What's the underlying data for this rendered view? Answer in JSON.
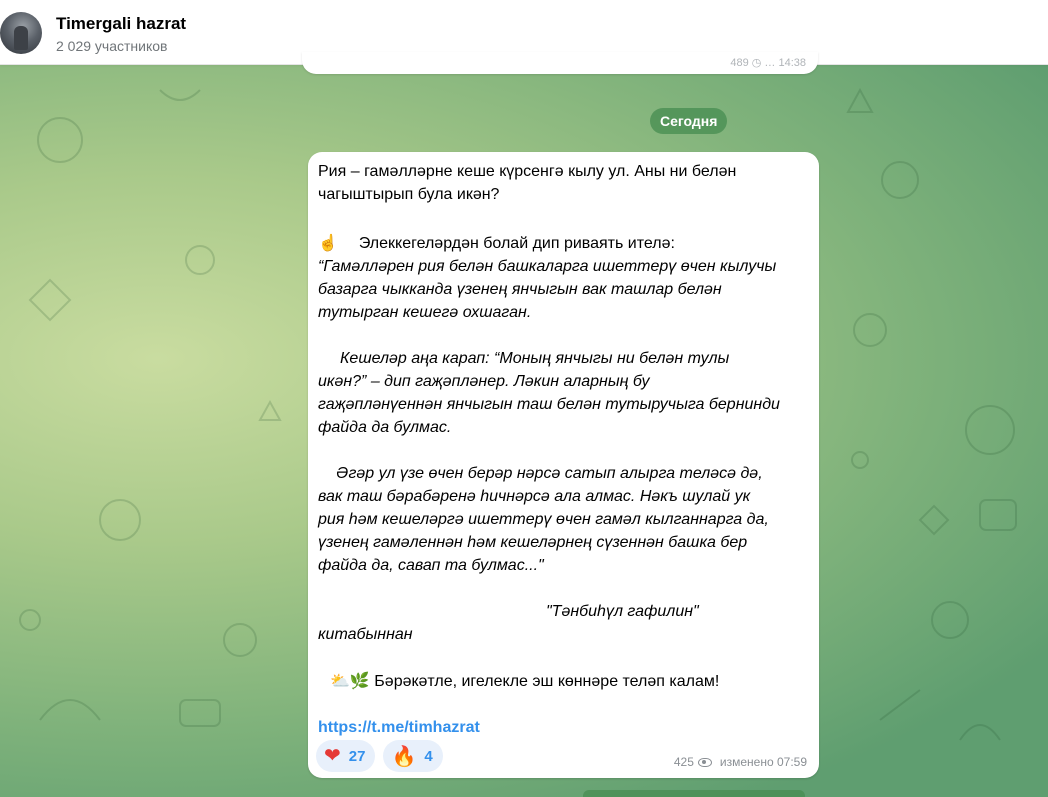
{
  "chat": {
    "title": "Timergali hazrat",
    "subtitle": "2 029 участников"
  },
  "prev_message": {
    "meta": "489 ◷ … 14:38"
  },
  "date_separator": "Сегодня",
  "message": {
    "line1": "Рия – гамәлләрне кеше күрсенгә кылу ул. Аны ни белән",
    "line2": "чагыштырып була икән?",
    "pointer_emoji": "☝️",
    "intro": "Элеккегеләрдән болай дип риваять ителә:",
    "q1": "“Гамәлләрен рия белән башкаларга ишеттерү өчен кылучы",
    "q2": "базарга чыкканда үзенең янчыгын вак ташлар белән",
    "q3": "тутырган кешегә охшаган.",
    "q4": "Кешеләр аңа карап: “Моның янчыгы ни белән тулы",
    "q5": "икән?” – дип гаҗәпләнер. Ләкин аларның бу",
    "q6": "гаҗәпләнүеннән янчыгын таш белән тутыручыга бернинди",
    "q7": "файда да булмас.",
    "q8": "Әгәр  ул үзе өчен берәр нәрсә сатып алырга теләсә дә,",
    "q9": "вак таш бәрабәренә һичнәрсә ала алмас. Нәкъ шулай ук",
    "q10": "рия һәм кешеләргә ишеттерү өчен гамәл кылганнарга да,",
    "q11": "үзенең гамәленнән һәм кешеләрнең сүзеннән башка  бер",
    "q12": "файда да, савап та булмас...\"",
    "source1": "\"Тәнбиһүл гафилин\"",
    "source2": "китабыннан",
    "wish_emoji": "⛅🌿",
    "wish": "Бәрәкәтле, игелекле эш көннәре теләп калам!",
    "link": "https://t.me/timhazrat",
    "reactions": [
      {
        "emoji": "❤",
        "count": "27"
      },
      {
        "emoji": "🔥",
        "count": "4"
      }
    ],
    "views": "425",
    "edited": "изменено 07:59"
  }
}
